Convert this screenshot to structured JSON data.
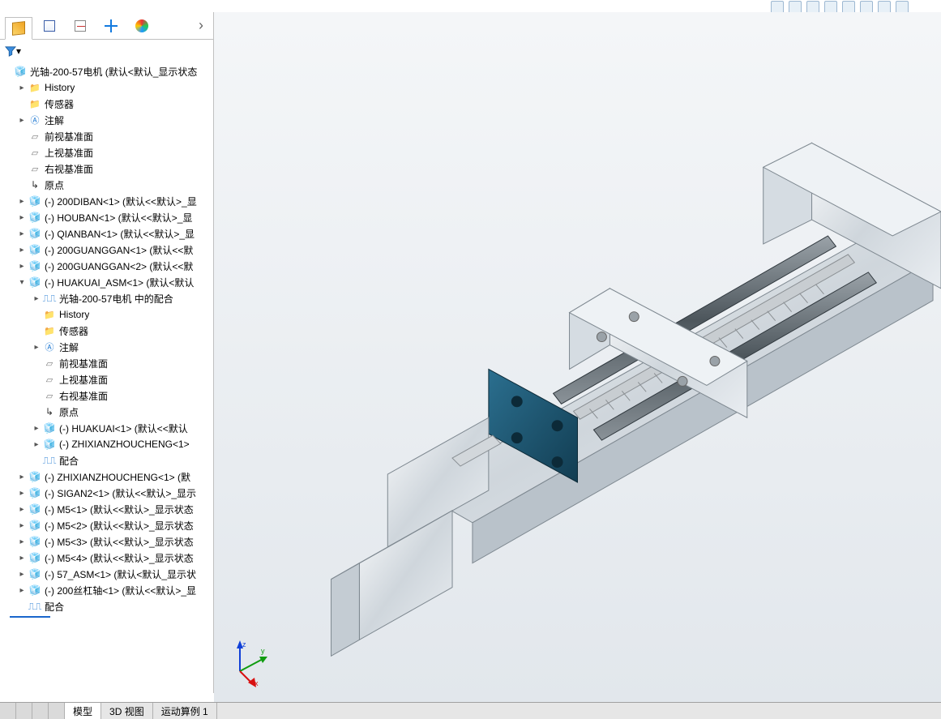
{
  "toolbar_top": {
    "buttons": [
      "zoom-fit",
      "zoom-area",
      "prev-view",
      "section",
      "display-style",
      "hide-show",
      "scene",
      "camera",
      "view-sel",
      "decals",
      "more"
    ]
  },
  "panel_tabs": [
    {
      "id": "feature-manager",
      "icon": "cube3",
      "selected": true
    },
    {
      "id": "property-manager",
      "icon": "grid4"
    },
    {
      "id": "configuration-manager",
      "icon": "dim"
    },
    {
      "id": "dimxpert",
      "icon": "cross"
    },
    {
      "id": "appearance",
      "icon": "ball"
    }
  ],
  "filter_tip": "筛选",
  "tree": [
    {
      "d": 0,
      "exp": "",
      "ic": "asm",
      "t": "光轴-200-57电机  (默认<默认_显示状态"
    },
    {
      "d": 1,
      "exp": "▸",
      "ic": "fold",
      "t": "History"
    },
    {
      "d": 1,
      "exp": "",
      "ic": "fold",
      "t": "传感器"
    },
    {
      "d": 1,
      "exp": "▸",
      "ic": "ann",
      "t": "注解"
    },
    {
      "d": 1,
      "exp": "",
      "ic": "plane",
      "t": "前视基准面"
    },
    {
      "d": 1,
      "exp": "",
      "ic": "plane",
      "t": "上视基准面"
    },
    {
      "d": 1,
      "exp": "",
      "ic": "plane",
      "t": "右视基准面"
    },
    {
      "d": 1,
      "exp": "",
      "ic": "orig",
      "t": "原点"
    },
    {
      "d": 1,
      "exp": "▸",
      "ic": "part",
      "t": "(-) 200DIBAN<1> (默认<<默认>_显"
    },
    {
      "d": 1,
      "exp": "▸",
      "ic": "part",
      "t": "(-) HOUBAN<1> (默认<<默认>_显"
    },
    {
      "d": 1,
      "exp": "▸",
      "ic": "part",
      "t": "(-) QIANBAN<1> (默认<<默认>_显"
    },
    {
      "d": 1,
      "exp": "▸",
      "ic": "part",
      "t": "(-) 200GUANGGAN<1> (默认<<默"
    },
    {
      "d": 1,
      "exp": "▸",
      "ic": "part",
      "t": "(-) 200GUANGGAN<2> (默认<<默"
    },
    {
      "d": 1,
      "exp": "▾",
      "ic": "asm",
      "t": "(-) HUAKUAI_ASM<1> (默认<默认"
    },
    {
      "d": 2,
      "exp": "▸",
      "ic": "mate",
      "t": "光轴-200-57电机 中的配合"
    },
    {
      "d": 2,
      "exp": "",
      "ic": "fold",
      "t": "History"
    },
    {
      "d": 2,
      "exp": "",
      "ic": "fold",
      "t": "传感器"
    },
    {
      "d": 2,
      "exp": "▸",
      "ic": "ann",
      "t": "注解"
    },
    {
      "d": 2,
      "exp": "",
      "ic": "plane",
      "t": "前视基准面"
    },
    {
      "d": 2,
      "exp": "",
      "ic": "plane",
      "t": "上视基准面"
    },
    {
      "d": 2,
      "exp": "",
      "ic": "plane",
      "t": "右视基准面"
    },
    {
      "d": 2,
      "exp": "",
      "ic": "orig",
      "t": "原点"
    },
    {
      "d": 2,
      "exp": "▸",
      "ic": "part",
      "t": "(-) HUAKUAI<1> (默认<<默认"
    },
    {
      "d": 2,
      "exp": "▸",
      "ic": "part",
      "t": "(-) ZHIXIANZHOUCHENG<1>"
    },
    {
      "d": 2,
      "exp": "",
      "ic": "mate",
      "t": "配合"
    },
    {
      "d": 1,
      "exp": "▸",
      "ic": "part",
      "t": "(-) ZHIXIANZHOUCHENG<1> (默"
    },
    {
      "d": 1,
      "exp": "▸",
      "ic": "part",
      "t": "(-) SIGAN2<1> (默认<<默认>_显示"
    },
    {
      "d": 1,
      "exp": "▸",
      "ic": "part",
      "t": "(-) M5<1> (默认<<默认>_显示状态"
    },
    {
      "d": 1,
      "exp": "▸",
      "ic": "part",
      "t": "(-) M5<2> (默认<<默认>_显示状态"
    },
    {
      "d": 1,
      "exp": "▸",
      "ic": "part",
      "t": "(-) M5<3> (默认<<默认>_显示状态"
    },
    {
      "d": 1,
      "exp": "▸",
      "ic": "part",
      "t": "(-) M5<4> (默认<<默认>_显示状态"
    },
    {
      "d": 1,
      "exp": "▸",
      "ic": "asm",
      "t": "(-) 57_ASM<1> (默认<默认_显示状"
    },
    {
      "d": 1,
      "exp": "▸",
      "ic": "part",
      "t": "(-) 200丝杠轴<1> (默认<<默认>_显"
    },
    {
      "d": 1,
      "exp": "",
      "ic": "mate",
      "t": "配合",
      "sel": true
    }
  ],
  "bottom_tabs": [
    {
      "label": "模型",
      "active": true
    },
    {
      "label": "3D 视图",
      "active": false
    },
    {
      "label": "运动算例 1",
      "active": false
    }
  ],
  "triad": {
    "x": "x",
    "y": "y",
    "z": "z"
  }
}
